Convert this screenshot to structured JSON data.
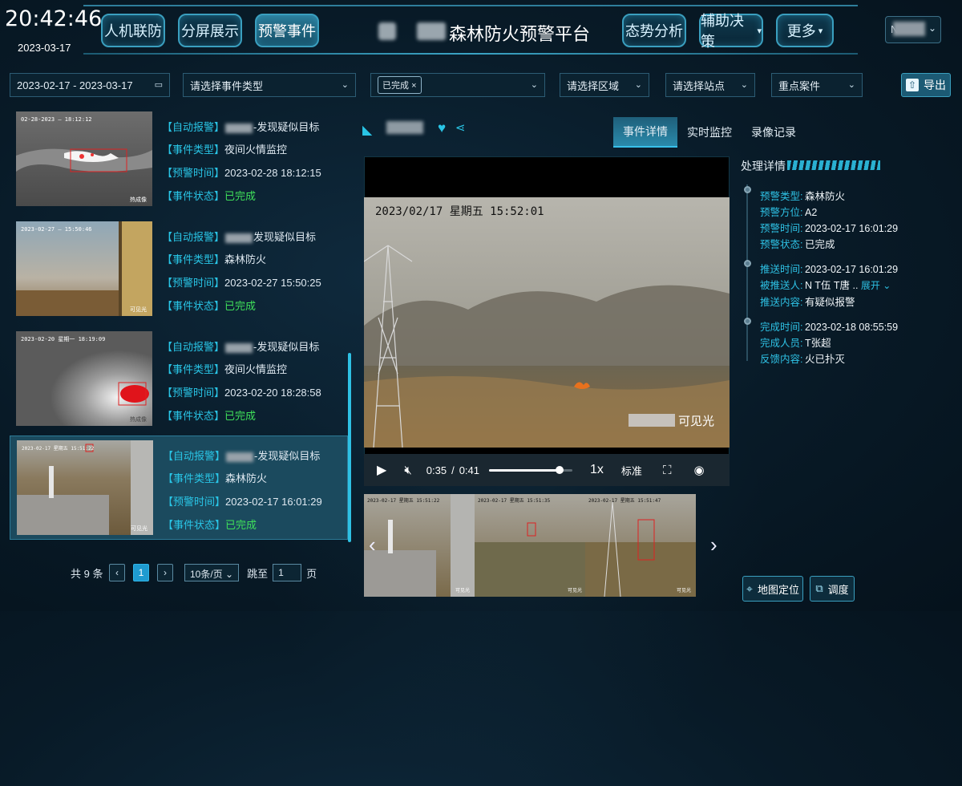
{
  "header": {
    "time": "20:42:46",
    "date": "2023-03-17",
    "platform_title": "森林防火预警平台",
    "nav_left": [
      "人机联防",
      "分屏展示",
      "预警事件"
    ],
    "nav_right": [
      "态势分析",
      "辅助决策",
      "更多"
    ],
    "user_initial": "N"
  },
  "filters": {
    "date_range": "2023-02-17 - 2023-03-17",
    "event_type_placeholder": "请选择事件类型",
    "status_tag": "已完成",
    "region_placeholder": "请选择区域",
    "station_placeholder": "请选择站点",
    "key_case": "重点案件",
    "export_label": "导出"
  },
  "events": [
    {
      "tag": "【自动报警】",
      "title_suffix": "-发现疑似目标",
      "type_label": "【事件类型】",
      "type": "夜间火情监控",
      "time_label": "【预警时间】",
      "time": "2023-02-28 18:12:15",
      "status_label": "【事件状态】",
      "status": "已完成",
      "thumb_caption": "02-28-2023 — 18:12:12",
      "thumb_corner": "热成像"
    },
    {
      "tag": "【自动报警】",
      "title_suffix": "发现疑似目标",
      "type_label": "【事件类型】",
      "type": "森林防火",
      "time_label": "【预警时间】",
      "time": "2023-02-27 15:50:25",
      "status_label": "【事件状态】",
      "status": "已完成",
      "thumb_caption": "2023-02-27 — 15:50:46",
      "thumb_corner": "可见光"
    },
    {
      "tag": "【自动报警】",
      "title_suffix": "-发现疑似目标",
      "type_label": "【事件类型】",
      "type": "夜间火情监控",
      "time_label": "【预警时间】",
      "time": "2023-02-20 18:28:58",
      "status_label": "【事件状态】",
      "status": "已完成",
      "thumb_caption": "2023-02-20 星期一 18:19:09",
      "thumb_corner": "热成像"
    },
    {
      "tag": "【自动报警】",
      "title_suffix": "-发现疑似目标",
      "type_label": "【事件类型】",
      "type": "森林防火",
      "time_label": "【预警时间】",
      "time": "2023-02-17 16:01:29",
      "status_label": "【事件状态】",
      "status": "已完成",
      "thumb_caption": "2023-02-17 星期五 15:51:22",
      "thumb_corner": "可见光"
    }
  ],
  "pagination": {
    "total": "共 9 条",
    "current_page": "1",
    "page_size": "10条/页",
    "jump_label": "跳至",
    "jump_value": "1",
    "page_unit": "页"
  },
  "center": {
    "tabs": [
      "事件详情",
      "实时监控",
      "录像记录"
    ],
    "video_overlay_time": "2023/02/17 星期五 15:52:01",
    "video_corner_label": "可见光",
    "current_time": "0:35",
    "time_separator": "/",
    "duration": "0:41",
    "progress_fraction": 0.85,
    "speed": "1x",
    "quality": "标准",
    "thumb_captions": [
      "2023-02-17 星期五 15:51:22",
      "2023-02-17 星期五 15:51:35",
      "2023-02-17 星期五 15:51:47"
    ],
    "thumb_corners": [
      "可见光",
      "可见光",
      "可见光"
    ]
  },
  "details": {
    "title": "处理详情",
    "group1": [
      {
        "k": "预警类型:",
        "v": "森林防火"
      },
      {
        "k": "预警方位:",
        "v": "A2"
      },
      {
        "k": "预警时间:",
        "v": "2023-02-17 16:01:29"
      },
      {
        "k": "预警状态:",
        "v": "已完成"
      }
    ],
    "group2": [
      {
        "k": "推送时间:",
        "v": "2023-02-17 16:01:29"
      },
      {
        "k": "被推送人:",
        "v": "N  T伍  T唐 .."
      },
      {
        "k": "推送内容:",
        "v": "有疑似报警"
      }
    ],
    "expand_label": "展开",
    "group3": [
      {
        "k": "完成时间:",
        "v": "2023-02-18 08:55:59"
      },
      {
        "k": "完成人员:",
        "v": "T张超"
      },
      {
        "k": "反馈内容:",
        "v": "火已扑灭"
      }
    ],
    "map_button": "地图定位",
    "dispatch_button": "调度"
  },
  "colors": {
    "accent": "#2ec1e4",
    "status_done": "#3fe05a",
    "panel_bg": "#081a27"
  }
}
